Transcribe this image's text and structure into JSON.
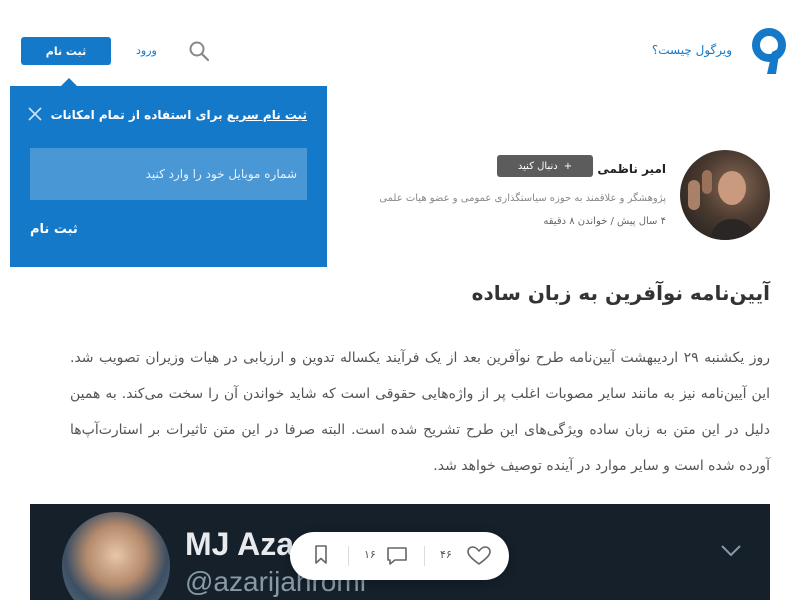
{
  "header": {
    "what_is_link": "ویرگول چیست؟",
    "login_label": "ورود",
    "signup_label": "ثبت نام",
    "brand_color": "#1479c9"
  },
  "signup_popover": {
    "title_em": "ثبت نام سریع",
    "title_rest": " برای استفاده از تمام امکانات",
    "phone_placeholder": "شماره موبایل خود را وارد کنید",
    "submit_label": "ثبت نام"
  },
  "author": {
    "name": "امیر ناظمی",
    "follow_label": "دنبال کنید",
    "follow_icon": "+",
    "bio": "پژوهشگر و علاقمند به حوزه سیاستگذاری عمومی و عضو هیات علمی",
    "meta": "۴ سال پیش / خواندن ۸ دقیقه"
  },
  "article": {
    "title": "آیین‌نامه نوآفرین به زبان ساده",
    "body": "روز یکشنبه ۲۹ اردیبهشت آیین‌نامه طرح نوآفرین بعد از یک فرآیند یکساله تدوین و ارزیابی در هیات وزیران تصویب شد. این آیین‌نامه نیز به مانند سایر مصوبات اغلب پر از واژه‌هایی حقوقی است که شاید خواندن آن را سخت می‌کند. به همین دلیل در این متن به زبان ساده ویژگی‌های این طرح تشریح شده است. البته صرفا در این متن تاثیرات بر استارت‌آپ‌ها آورده شده است و سایر موارد در آینده توصیف خواهد شد."
  },
  "tweet": {
    "name": "MJ Aza",
    "handle": "@azarijahromi"
  },
  "actions": {
    "likes": "۴۶",
    "comments": "۱۶"
  }
}
